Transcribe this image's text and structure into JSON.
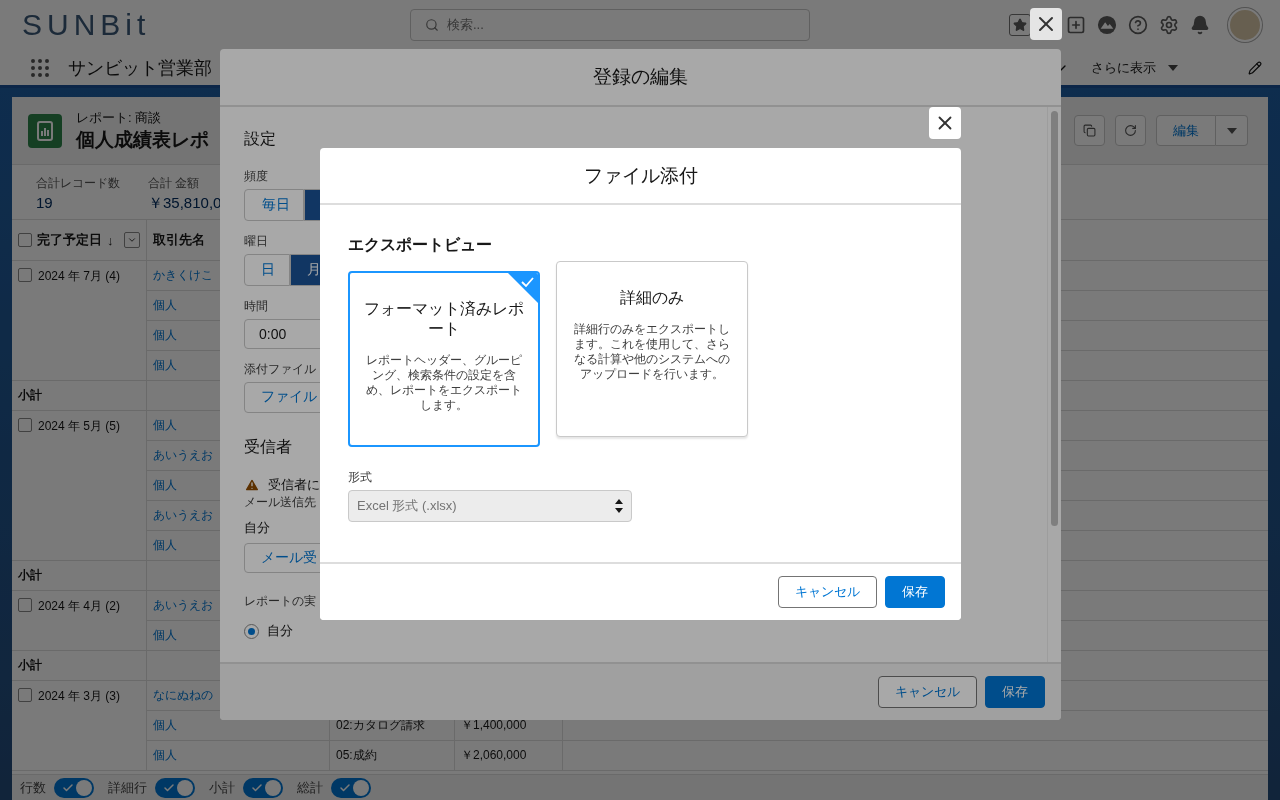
{
  "header": {
    "logo": "SUNBit",
    "search": {
      "placeholder": "検索..."
    }
  },
  "nav": {
    "app_name": "サンビット営業部",
    "more": "さらに表示"
  },
  "report": {
    "type_label": "レポート: 商談",
    "title": "個人成績表レポ",
    "edit_button": "編集"
  },
  "stats": [
    {
      "label": "合計レコード数",
      "value": "19"
    },
    {
      "label": "合計 金額",
      "value": "￥35,810,0"
    }
  ],
  "table": {
    "columns": [
      {
        "label": "完了予定日",
        "sort_icon": "↓",
        "checked": false
      },
      {
        "label": "取引先名"
      }
    ],
    "groups": [
      {
        "label": "2024 年 7月 (4)",
        "checked": false,
        "subtotal": "小計",
        "rows": [
          {
            "account": "かきくけこ"
          },
          {
            "account": "個人"
          },
          {
            "account": "個人"
          },
          {
            "account": "個人"
          }
        ]
      },
      {
        "label": "2024 年 5月 (5)",
        "checked": false,
        "subtotal": "小計",
        "rows": [
          {
            "account": "個人"
          },
          {
            "account": "あいうえお"
          },
          {
            "account": "個人"
          },
          {
            "account": "あいうえお"
          },
          {
            "account": "個人"
          }
        ]
      },
      {
        "label": "2024 年 4月 (2)",
        "checked": false,
        "subtotal": "小計",
        "rows": [
          {
            "account": "あいうえお"
          },
          {
            "account": "個人"
          }
        ]
      },
      {
        "label": "2024 年 3月 (3)",
        "checked": false,
        "rows": [
          {
            "account": "なにぬねの"
          },
          {
            "account": "個人",
            "stage": "02:カタログ請求",
            "amount": "￥1,400,000"
          },
          {
            "account": "個人",
            "stage": "05:成約",
            "amount": "￥2,060,000"
          }
        ]
      }
    ]
  },
  "footer": {
    "toggles": [
      {
        "label": "行数",
        "on": true
      },
      {
        "label": "詳細行",
        "on": true
      },
      {
        "label": "小計",
        "on": true
      },
      {
        "label": "総計",
        "on": true
      }
    ]
  },
  "edit_dialog": {
    "title": "登録の編集",
    "settings_heading": "設定",
    "frequency": {
      "label": "頻度",
      "options": [
        {
          "label": "毎日",
          "selected": false
        },
        {
          "selected": true
        }
      ]
    },
    "weekday": {
      "label": "曜日",
      "options": [
        {
          "label": "日",
          "selected": false
        },
        {
          "label": "月",
          "selected": true
        }
      ]
    },
    "time": {
      "label": "時間",
      "value": "0:00"
    },
    "attachment": {
      "label": "添付ファイル",
      "button": "ファイル"
    },
    "recipients_heading": "受信者",
    "warning": "受信者に",
    "email_to": {
      "label": "メール送信先",
      "value": "自分"
    },
    "recipients_button": "メール受",
    "run_as": {
      "label": "レポートの実",
      "options": [
        {
          "label": "自分",
          "selected": true
        }
      ]
    },
    "buttons": {
      "cancel": "キャンセル",
      "save": "保存"
    }
  },
  "attach_dialog": {
    "title": "ファイル添付",
    "section": "エクスポートビュー",
    "views": [
      {
        "title": "フォーマット済みレポート",
        "description": "レポートヘッダー、グルーピング、検索条件の設定を含め、レポートをエクスポートします。",
        "selected": true
      },
      {
        "title": "詳細のみ",
        "description": "詳細行のみをエクスポートします。これを使用して、さらなる計算や他のシステムへのアップロードを行います。",
        "selected": false
      }
    ],
    "format": {
      "label": "形式",
      "value": "Excel 形式 (.xlsx)",
      "disabled": true
    },
    "buttons": {
      "cancel": "キャンセル",
      "save": "保存"
    }
  }
}
